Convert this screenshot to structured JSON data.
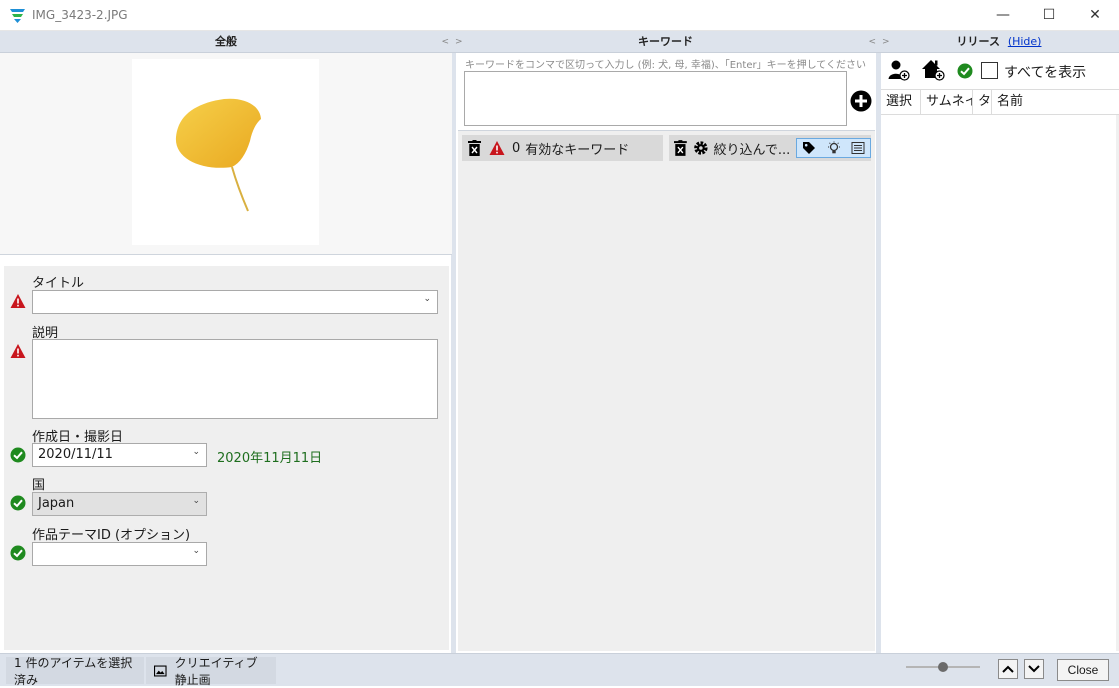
{
  "window": {
    "title": "IMG_3423-2.JPG",
    "minimize_glyph": "—",
    "maximize_glyph": "☐",
    "close_glyph": "✕"
  },
  "panes": {
    "general": {
      "title": "全般",
      "collapse_glyph": "<",
      "expand_glyph": ">"
    },
    "keywords": {
      "title": "キーワード",
      "collapse_glyph": "<",
      "expand_glyph": ">"
    },
    "releases": {
      "title": "リリース",
      "hide_link": "(Hide)"
    }
  },
  "form": {
    "title_label": "タイトル",
    "title_value": "",
    "description_label": "説明",
    "description_value": "",
    "date_label": "作成日・撮影日",
    "date_value": "2020/11/11",
    "date_formatted": "2020年11月11日",
    "country_label": "国",
    "country_value": "Japan",
    "theme_label": "作品テーマID (オプション)",
    "theme_value": ""
  },
  "keywords": {
    "placeholder": "キーワードをコンマで区切って入力し (例: 犬, 母, 幸福)、「Enter」キーを押してください",
    "valid_count": "0",
    "valid_label": "有効なキーワード",
    "filter_label": "絞り込んで..."
  },
  "releases": {
    "show_all_label": "すべてを表示",
    "columns": [
      "選択",
      "サムネイル",
      "タ",
      "名前"
    ]
  },
  "statusbar": {
    "selection_text": "1 件のアイテムを選択済み",
    "media_type": "クリエイティブ静止画",
    "close_label": "Close"
  },
  "colors": {
    "header_bg": "#dde3ec",
    "warning_red": "#c8161d",
    "ok_green": "#1f8a1f",
    "date_green": "#1e6e1e",
    "link_blue": "#0033cc",
    "leaf_yellow": "#f2c230"
  },
  "icons": {
    "app": "app-logo-icon",
    "warning": "warning-icon",
    "ok": "check-circle-icon",
    "add": "plus-circle-icon",
    "trash": "trash-icon",
    "gear": "gear-icon",
    "tag": "tag-icon",
    "bulb": "lightbulb-icon",
    "list": "list-icon",
    "add_person": "add-person-icon",
    "add_property": "add-property-icon",
    "image": "image-icon",
    "up": "chevron-up-icon",
    "down": "chevron-down-icon"
  }
}
